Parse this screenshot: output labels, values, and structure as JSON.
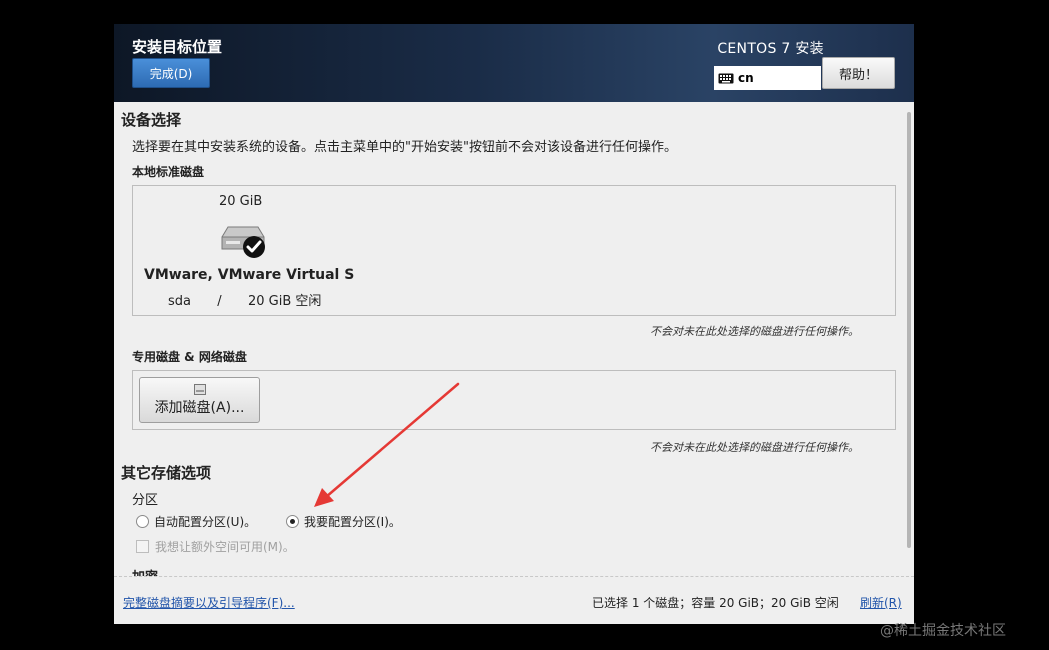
{
  "header": {
    "title": "安装目标位置",
    "done_label": "完成(D)",
    "product": "CENTOS 7 安装",
    "keyboard_layout": "cn",
    "help_label": "帮助！"
  },
  "device_selection": {
    "heading": "设备选择",
    "description": "选择要在其中安装系统的设备。点击主菜单中的\"开始安装\"按钮前不会对该设备进行任何操作。",
    "local_disks_label": "本地标准磁盘",
    "disk": {
      "size": "20 GiB",
      "name": "VMware, VMware Virtual S",
      "device": "sda",
      "separator": "/",
      "free": "20 GiB 空闲"
    },
    "local_note": "不会对未在此处选择的磁盘进行任何操作。",
    "special_disks_label": "专用磁盘 & 网络磁盘",
    "add_disk_label": "添加磁盘(A)...",
    "special_note": "不会对未在此处选择的磁盘进行任何操作。"
  },
  "other_storage": {
    "heading": "其它存储选项",
    "partition_label": "分区",
    "auto_partition_label": "自动配置分区(U)。",
    "manual_partition_label": "我要配置分区(I)。",
    "selected_partition": "manual",
    "extra_space_label": "我想让额外空间可用(M)。",
    "encryption_label": "加密"
  },
  "footer": {
    "summary_link": "完整磁盘摘要以及引导程序(F)...",
    "status": "已选择 1 个磁盘；容量 20 GiB；20 GiB 空闲",
    "refresh_label": "刷新(R)"
  },
  "watermark": "@稀土掘金技术社区",
  "colors": {
    "header_dark": "#0d1726",
    "header_light": "#2a4365",
    "primary_button": "#2d6bb3",
    "link": "#2255aa",
    "annotation_arrow": "#e53935"
  }
}
